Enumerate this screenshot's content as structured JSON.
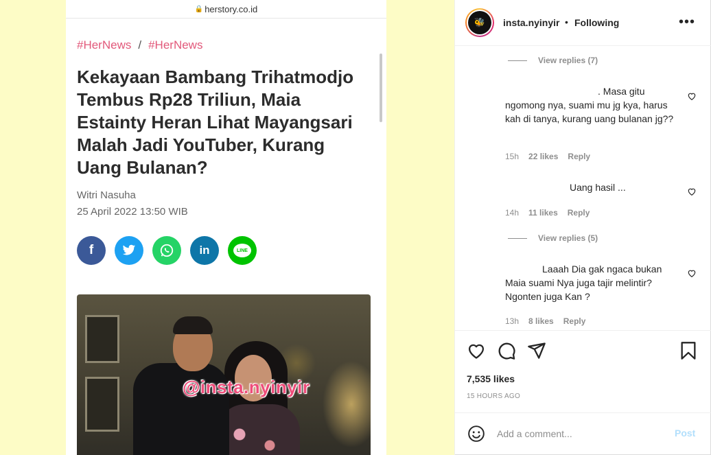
{
  "article": {
    "url": "herstory.co.id",
    "crumb1": "#HerNews",
    "crumb_sep": "/",
    "crumb2": "#HerNews",
    "headline": "Kekayaan Bambang Trihatmodjo Tembus Rp28 Triliun, Maia Estainty Heran Lihat Mayangsari Malah Jadi YouTuber, Kurang Uang Bulanan?",
    "author": "Witri Nasuha",
    "date": "25 April 2022 13:50 WIB",
    "share": [
      {
        "name": "facebook",
        "glyph": "f",
        "color": "#3b5998"
      },
      {
        "name": "twitter",
        "glyph": "🐦",
        "color": "#1da1f2"
      },
      {
        "name": "whatsapp",
        "glyph": "✆",
        "color": "#25d366"
      },
      {
        "name": "linkedin",
        "glyph": "in",
        "color": "#0e76a8"
      },
      {
        "name": "line",
        "glyph": "LINE",
        "color": "#00c300"
      }
    ],
    "watermark": "@insta.nyinyir"
  },
  "post": {
    "username": "insta.nyinyir",
    "dot": "•",
    "following_label": "Following",
    "likes": "7,535 likes",
    "time": "15 HOURS AGO",
    "add_comment_placeholder": "Add a comment...",
    "post_label": "Post"
  },
  "comments": [
    {
      "view_replies": "View replies (7)"
    },
    {
      "text_line1": ". Masa gitu",
      "text_rest": "ngomong nya, suami mu jg kya, harus kah di tanya, kurang uang bulanan jg??",
      "time": "15h",
      "likes": "22 likes",
      "reply": "Reply"
    },
    {
      "text_line1": "Uang hasil ...",
      "time": "14h",
      "likes": "11 likes",
      "reply": "Reply"
    },
    {
      "view_replies": "View replies (5)"
    },
    {
      "text_line1": "Laaah Dia gak ngaca bukan",
      "text_rest": "Maia suami Nya juga tajir melintir? Ngonten juga Kan ?",
      "time": "13h",
      "likes": "8 likes",
      "reply": "Reply"
    }
  ],
  "icons": {
    "more": "more-options-icon",
    "like": "heart-icon",
    "comment": "comment-icon",
    "share": "share-icon",
    "save": "bookmark-icon",
    "emoji": "emoji-icon"
  }
}
